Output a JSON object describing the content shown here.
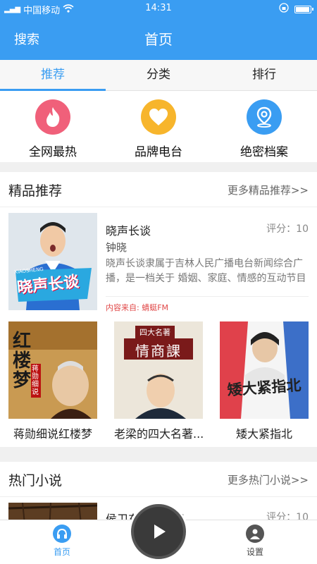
{
  "status_bar": {
    "carrier": "中国移动",
    "time": "14:31"
  },
  "app_bar": {
    "search_label": "搜索",
    "title": "首页"
  },
  "tabs": [
    {
      "label": "推荐"
    },
    {
      "label": "分类"
    },
    {
      "label": "排行"
    }
  ],
  "quick_links": [
    {
      "label": "全网最热",
      "icon": "flame-icon",
      "color": "#f0607a"
    },
    {
      "label": "品牌电台",
      "icon": "heart-icon",
      "color": "#f7b52c"
    },
    {
      "label": "绝密档案",
      "icon": "location-pin-icon",
      "color": "#3a9df2"
    }
  ],
  "featured": {
    "section_title": "精品推荐",
    "more_label": "更多精品推荐>>",
    "item": {
      "title": "晓声长谈",
      "rating": "评分：10",
      "author": "钟晓",
      "description": "晓声长谈隶属于吉林人民广播电台新闻综合广播，是一档关于 婚姻、家庭、情感的互动节目",
      "source": "内容来自: 蜻蜓FM",
      "cover_text": "晓声长谈",
      "cover_subtext": "XIAOSHENG"
    },
    "grid": [
      {
        "label": "蒋勋细说红楼梦",
        "cover_text": "红楼梦",
        "cover_sub": "蒋勋细说"
      },
      {
        "label": "老梁的四大名著...",
        "cover_top": "四大名著",
        "cover_text": "情商課"
      },
      {
        "label": "矮大紧指北",
        "cover_text": "矮大紧指北"
      }
    ]
  },
  "hot": {
    "section_title": "热门小说",
    "more_label": "更多热门小说>>",
    "item": {
      "title": "侯卫东官场笔记",
      "rating": "评分：10"
    }
  },
  "bottom_nav": {
    "home_label": "首页",
    "settings_label": "设置"
  },
  "colors": {
    "primary": "#3a9df2",
    "source_red": "#e04848"
  }
}
